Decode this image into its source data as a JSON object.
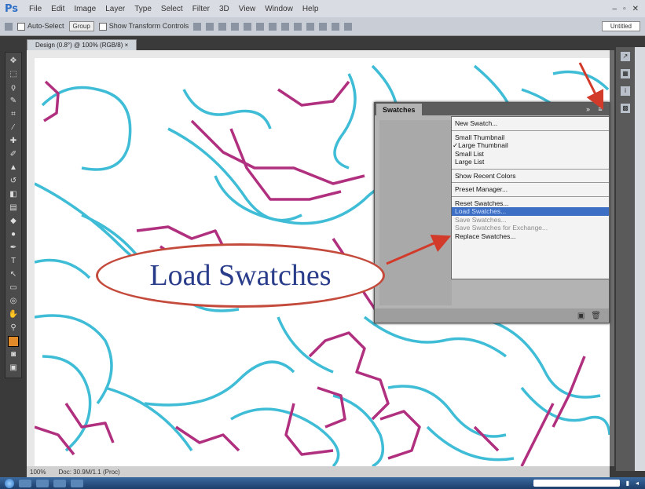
{
  "app": {
    "logo": "Ps"
  },
  "menubar": {
    "items": [
      "File",
      "Edit",
      "Image",
      "Layer",
      "Type",
      "Select",
      "Filter",
      "3D",
      "View",
      "Window",
      "Help"
    ]
  },
  "options_bar": {
    "auto_select_label": "Auto-Select",
    "auto_select_value": "Group",
    "show_transform_label": "Show Transform Controls",
    "workspace": "Untitled"
  },
  "document": {
    "tab_title": "Design (0.8°) @ 100% (RGB/8)",
    "zoom": "100%",
    "doc_info": "Doc: 30.9M/1.1 (Proc)"
  },
  "swatches_panel": {
    "title": "Swatches",
    "collapse_glyph": "»",
    "menu_glyph": "≡",
    "menu": {
      "groups": [
        [
          {
            "label": "New Swatch...",
            "state": "normal"
          }
        ],
        [
          {
            "label": "Small Thumbnail",
            "state": "normal"
          },
          {
            "label": "Large Thumbnail",
            "state": "checked"
          },
          {
            "label": "Small List",
            "state": "normal"
          },
          {
            "label": "Large List",
            "state": "normal"
          }
        ],
        [
          {
            "label": "Show Recent Colors",
            "state": "normal"
          }
        ],
        [
          {
            "label": "Preset Manager...",
            "state": "normal"
          }
        ],
        [
          {
            "label": "Reset Swatches...",
            "state": "normal"
          },
          {
            "label": "Load Swatches...",
            "state": "highlighted"
          },
          {
            "label": "Save Swatches...",
            "state": "disabled"
          },
          {
            "label": "Save Swatches for Exchange...",
            "state": "disabled"
          },
          {
            "label": "Replace Swatches...",
            "state": "normal"
          }
        ]
      ]
    },
    "check_glyph": "✓"
  },
  "callout": {
    "text": "Load Swatches"
  },
  "colors": {
    "cyan_stroke": "#3fbcd6",
    "magenta_stroke": "#b0307f",
    "arrow": "#d23a2a",
    "highlight": "#3d6fc4"
  }
}
